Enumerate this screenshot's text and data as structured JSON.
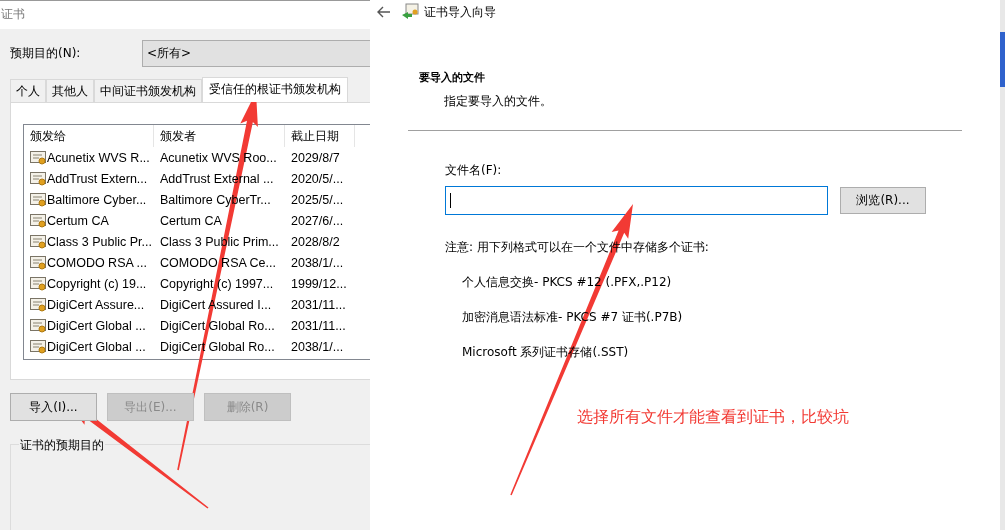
{
  "back_window": {
    "title": "证书",
    "purpose_label": "预期目的(N):",
    "purpose_value": "<所有>",
    "tabs": [
      {
        "label": "个人",
        "selected": false
      },
      {
        "label": "其他人",
        "selected": false
      },
      {
        "label": "中间证书颁发机构",
        "selected": false
      },
      {
        "label": "受信任的根证书颁发机构",
        "selected": true
      }
    ],
    "columns": [
      "颁发给",
      "颁发者",
      "截止日期"
    ],
    "rows": [
      [
        "Acunetix WVS R...",
        "Acunetix WVS Roo...",
        "2029/8/7"
      ],
      [
        "AddTrust Extern...",
        "AddTrust External ...",
        "2020/5/..."
      ],
      [
        "Baltimore Cyber...",
        "Baltimore CyberTr...",
        "2025/5/..."
      ],
      [
        "Certum CA",
        "Certum CA",
        "2027/6/..."
      ],
      [
        "Class 3 Public Pr...",
        "Class 3 Public Prim...",
        "2028/8/2"
      ],
      [
        "COMODO RSA ...",
        "COMODO RSA Ce...",
        "2038/1/..."
      ],
      [
        "Copyright (c) 19...",
        "Copyright (c) 1997...",
        "1999/12..."
      ],
      [
        "DigiCert Assure...",
        "DigiCert Assured I...",
        "2031/11..."
      ],
      [
        "DigiCert Global ...",
        "DigiCert Global Ro...",
        "2031/11..."
      ],
      [
        "DigiCert Global ...",
        "DigiCert Global Ro...",
        "2038/1/..."
      ]
    ],
    "buttons": [
      {
        "label": "导入(I)...",
        "disabled": false
      },
      {
        "label": "导出(E)...",
        "disabled": true
      },
      {
        "label": "删除(R)",
        "disabled": true
      }
    ],
    "group_title": "证书的预期目的"
  },
  "wizard": {
    "title": "证书导入向导",
    "heading": "要导入的文件",
    "subheading": "指定要导入的文件。",
    "file_label": "文件名(F):",
    "browse_button": "浏览(R)...",
    "note": "注意: 用下列格式可以在一个文件中存储多个证书:",
    "formats": [
      "个人信息交换- PKCS #12 (.PFX,.P12)",
      "加密消息语法标准- PKCS #7 证书(.P7B)",
      "Microsoft 系列证书存储(.SST)"
    ]
  },
  "annotation": {
    "text": "选择所有文件才能查看到证书，比较坑"
  }
}
